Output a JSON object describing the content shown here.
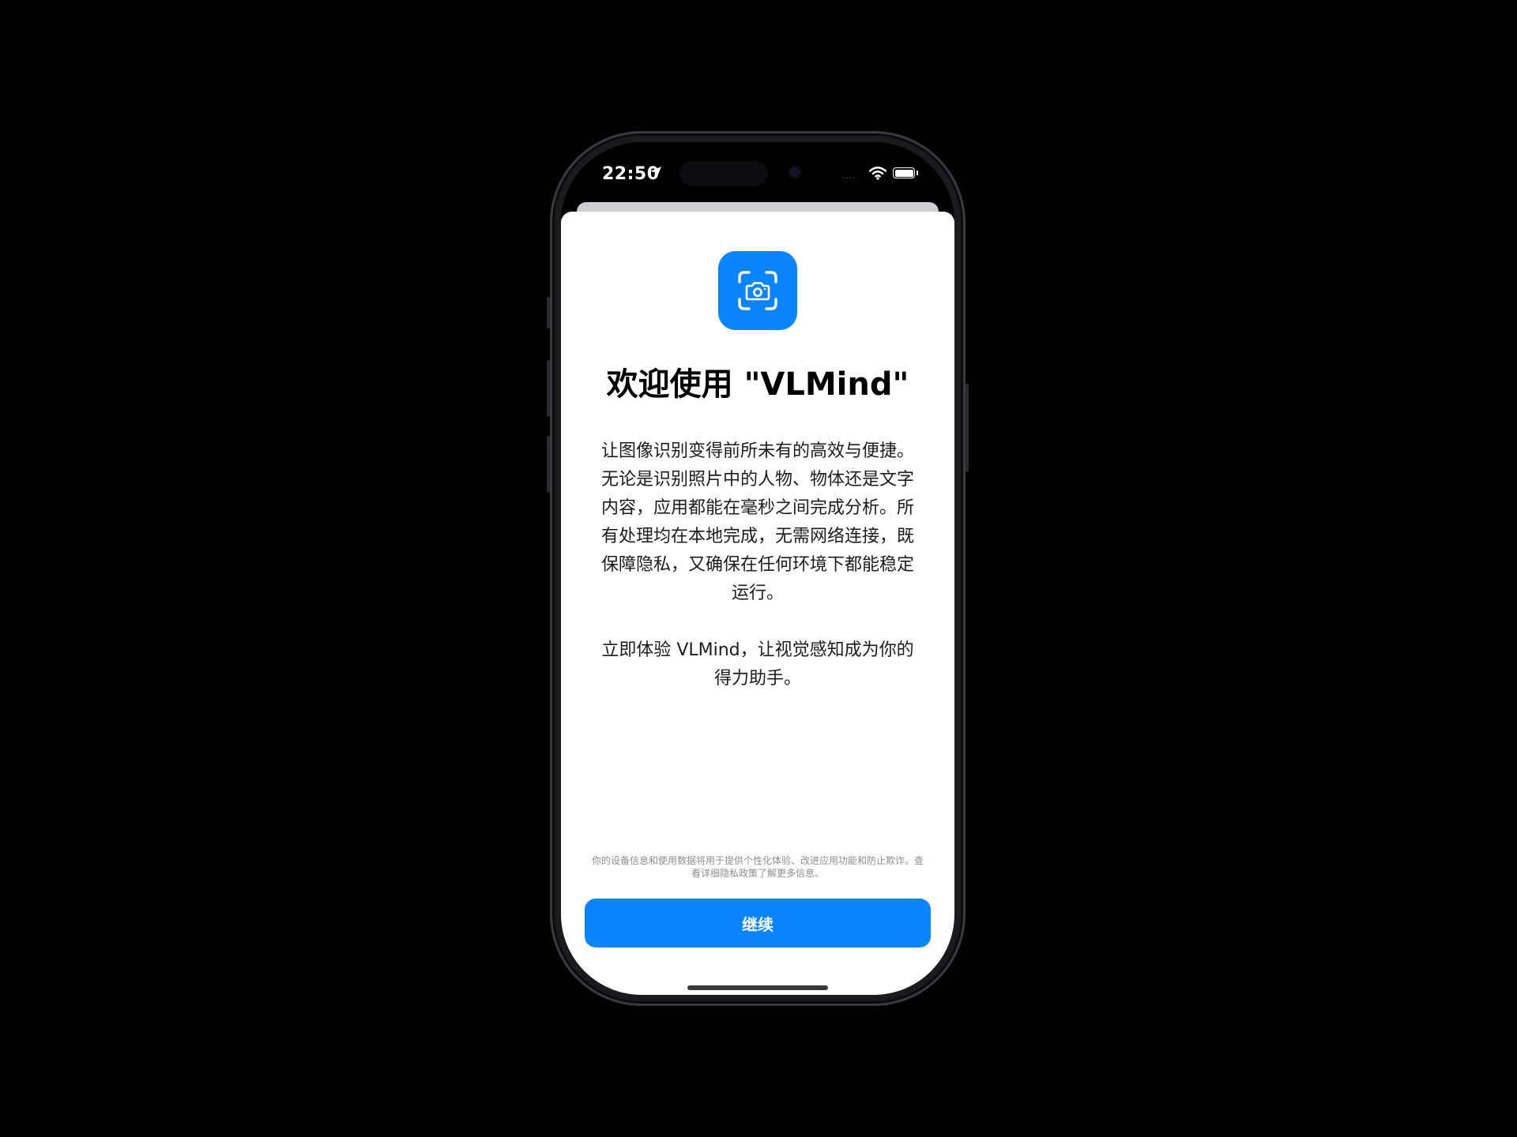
{
  "status_bar": {
    "time": "22:50",
    "signal_dots": "....",
    "location_icon": "location-arrow-icon",
    "wifi_icon": "wifi-icon",
    "battery_icon": "battery-icon"
  },
  "welcome": {
    "icon": "camera-viewfinder-icon",
    "title": "欢迎使用 \"VLMind\"",
    "description": "让图像识别变得前所未有的高效与便捷。无论是识别照片中的人物、物体还是文字内容，应用都能在毫秒之间完成分析。所有处理均在本地完成，无需网络连接，既保障隐私，又确保在任何环境下都能稳定运行。",
    "description_cta": "立即体验 VLMind，让视觉感知成为你的得力助手。",
    "privacy_note": "你的设备信息和使用数据将用于提供个性化体验、改进应用功能和防止欺诈。查看详细隐私政策了解更多信息。",
    "continue_label": "继续"
  },
  "colors": {
    "accent": "#0a84ff",
    "background": "#000000",
    "sheet": "#ffffff",
    "secondary_text": "#8e8e93"
  }
}
